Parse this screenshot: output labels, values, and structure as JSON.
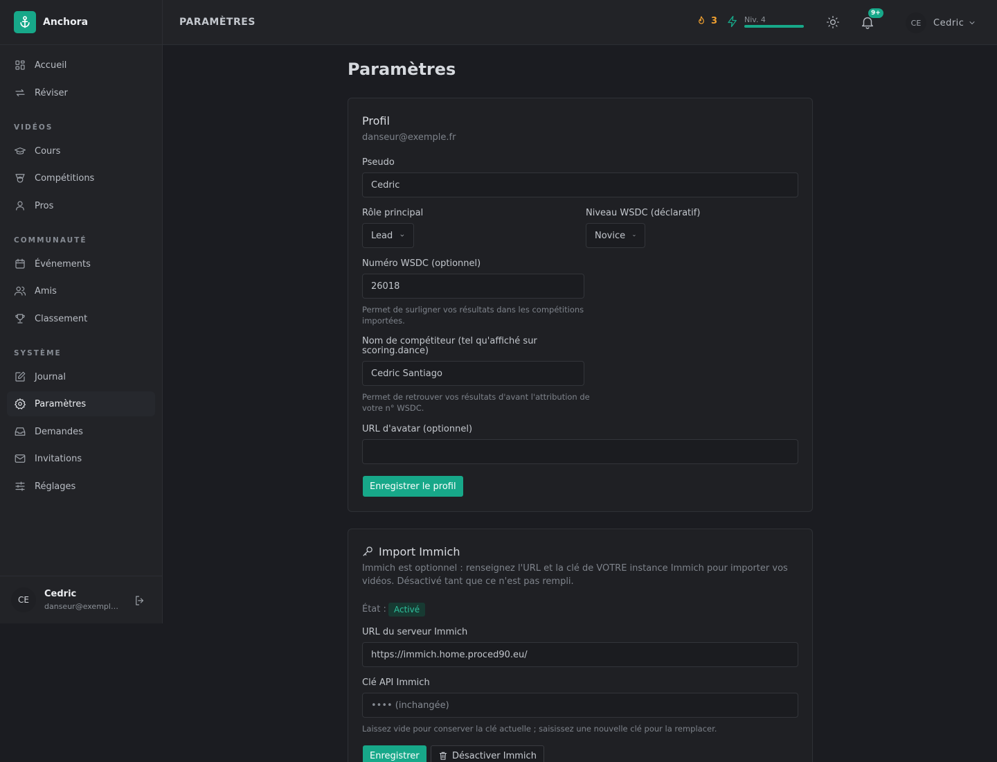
{
  "app": {
    "name": "Anchora"
  },
  "colors": {
    "accent": "#17a889",
    "streak": "#f0a030",
    "background": "#1b1c21"
  },
  "sidebar": {
    "items": [
      {
        "label": "Accueil",
        "icon": "dashboard-icon"
      },
      {
        "label": "Réviser",
        "icon": "repeat-icon"
      }
    ],
    "sections": [
      {
        "title": "VIDÉOS",
        "items": [
          {
            "label": "Cours",
            "icon": "graduation-cap-icon"
          },
          {
            "label": "Compétitions",
            "icon": "award-icon"
          },
          {
            "label": "Pros",
            "icon": "user-icon"
          }
        ]
      },
      {
        "title": "COMMUNAUTÉ",
        "items": [
          {
            "label": "Événements",
            "icon": "calendar-icon"
          },
          {
            "label": "Amis",
            "icon": "users-icon"
          },
          {
            "label": "Classement",
            "icon": "trophy-icon"
          }
        ]
      },
      {
        "title": "SYSTÈME",
        "items": [
          {
            "label": "Journal",
            "icon": "edit-icon"
          },
          {
            "label": "Paramètres",
            "icon": "gear-icon",
            "active": true
          },
          {
            "label": "Demandes",
            "icon": "inbox-icon"
          },
          {
            "label": "Invitations",
            "icon": "mail-icon"
          },
          {
            "label": "Réglages",
            "icon": "sliders-icon"
          }
        ]
      }
    ],
    "user": {
      "initials": "CE",
      "name": "Cedric",
      "email": "danseur@exemple.fr"
    }
  },
  "topbar": {
    "breadcrumb": "PARAMÈTRES",
    "streak": "3",
    "level_label": "Niv. 4",
    "level_progress": 1.0,
    "notifications_badge": "9+",
    "user_initials": "CE",
    "user_name": "Cedric"
  },
  "page": {
    "title": "Paramètres"
  },
  "profile": {
    "title": "Profil",
    "email": "danseur@exemple.fr",
    "pseudo_label": "Pseudo",
    "pseudo_value": "Cedric",
    "role_label": "Rôle principal",
    "role_value": "Lead",
    "level_label": "Niveau WSDC (déclaratif)",
    "level_value": "Novice",
    "wsdc_label": "Numéro WSDC (optionnel)",
    "wsdc_value": "26018",
    "wsdc_help": "Permet de surligner vos résultats dans les compétitions importées.",
    "competitor_label": "Nom de compétiteur (tel qu'affiché sur scoring.dance)",
    "competitor_value": "Cedric Santiago",
    "competitor_help": "Permet de retrouver vos résultats d'avant l'attribution de votre n° WSDC.",
    "avatar_label": "URL d'avatar (optionnel)",
    "avatar_value": "",
    "save_label": "Enregistrer le profil"
  },
  "immich": {
    "title": "Import Immich",
    "description": "Immich est optionnel : renseignez l'URL et la clé de VOTRE instance Immich pour importer vos vidéos. Désactivé tant que ce n'est pas rempli.",
    "state_label": "État :",
    "state_value": "Activé",
    "url_label": "URL du serveur Immich",
    "url_value": "https://immich.home.proced90.eu/",
    "key_label": "Clé API Immich",
    "key_placeholder": "•••• (inchangée)",
    "key_help": "Laissez vide pour conserver la clé actuelle ; saisissez une nouvelle clé pour la remplacer.",
    "save_label": "Enregistrer",
    "disable_label": "Désactiver Immich"
  }
}
